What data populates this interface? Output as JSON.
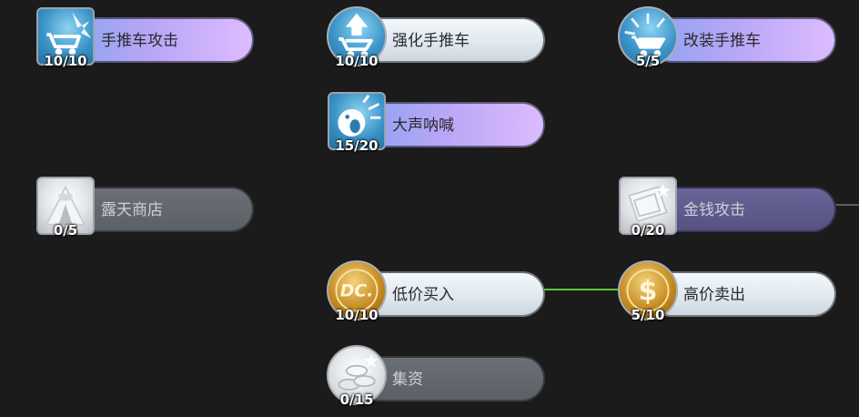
{
  "skills": [
    {
      "name": "手推车攻击",
      "count": "10/10"
    },
    {
      "name": "强化手推车",
      "count": "10/10"
    },
    {
      "name": "改装手推车",
      "count": "5/5"
    },
    {
      "name": "大声呐喊",
      "count": "15/20"
    },
    {
      "name": "露天商店",
      "count": "0/5"
    },
    {
      "name": "金钱攻击",
      "count": "0/20"
    },
    {
      "name": "低价买入",
      "count": "10/10"
    },
    {
      "name": "高价卖出",
      "count": "5/10"
    },
    {
      "name": "集资",
      "count": "0/15"
    }
  ],
  "colors": {
    "background": "#1b1b1b",
    "connector_active": "#5ec13a",
    "connector_inactive": "#5b5f63"
  },
  "icons": [
    "cart-attack-icon",
    "cart-upgrade-icon",
    "cart-modify-icon",
    "shout-icon",
    "tent-shop-icon",
    "money-attack-icon",
    "dc-coin-icon",
    "dollar-coin-icon",
    "coin-pile-icon"
  ]
}
